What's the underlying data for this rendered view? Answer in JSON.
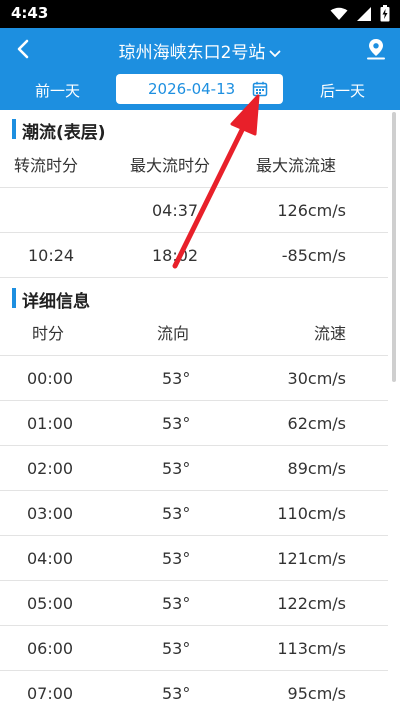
{
  "status_bar": {
    "time": "4:43"
  },
  "header": {
    "station": "琼州海峡东口2号站",
    "prev_day": "前一天",
    "date": "2026-04-13",
    "next_day": "后一天"
  },
  "tide_section": {
    "title": "潮流(表层)",
    "columns": [
      "转流时分",
      "最大流时分",
      "最大流流速"
    ],
    "rows": [
      {
        "turn": "",
        "max_time": "04:37",
        "max_speed": "126cm/s"
      },
      {
        "turn": "10:24",
        "max_time": "18:02",
        "max_speed": "-85cm/s"
      }
    ]
  },
  "detail_section": {
    "title": "详细信息",
    "columns": [
      "时分",
      "流向",
      "流速"
    ],
    "rows": [
      {
        "time": "00:00",
        "direction": "53°",
        "speed": "30cm/s"
      },
      {
        "time": "01:00",
        "direction": "53°",
        "speed": "62cm/s"
      },
      {
        "time": "02:00",
        "direction": "53°",
        "speed": "89cm/s"
      },
      {
        "time": "03:00",
        "direction": "53°",
        "speed": "110cm/s"
      },
      {
        "time": "04:00",
        "direction": "53°",
        "speed": "121cm/s"
      },
      {
        "time": "05:00",
        "direction": "53°",
        "speed": "122cm/s"
      },
      {
        "time": "06:00",
        "direction": "53°",
        "speed": "113cm/s"
      },
      {
        "time": "07:00",
        "direction": "53°",
        "speed": "95cm/s"
      }
    ]
  },
  "colors": {
    "primary": "#1d8fe0",
    "annotation_arrow": "#e8202a"
  }
}
